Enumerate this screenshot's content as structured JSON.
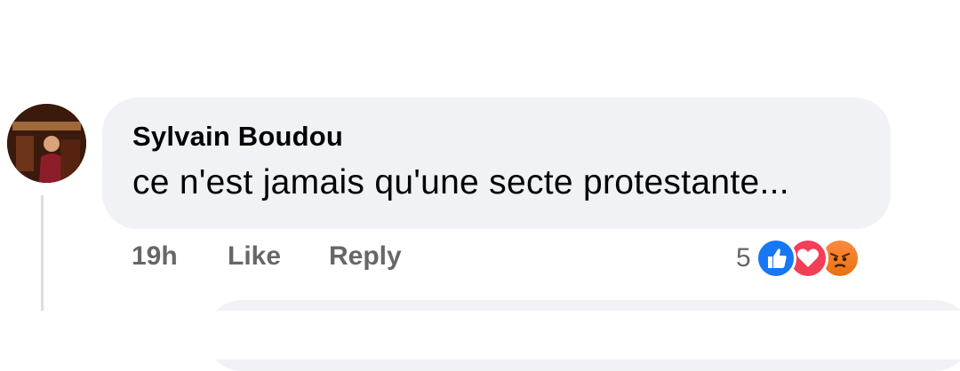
{
  "comment": {
    "author": "Sylvain Boudou",
    "text": "ce n'est jamais qu'une secte protestante...",
    "time": "19h",
    "like_label": "Like",
    "reply_label": "Reply",
    "reactions": {
      "count": "5",
      "types": [
        "like-icon",
        "love-icon",
        "angry-icon"
      ]
    }
  },
  "colors": {
    "bubble": "#f0f2f5",
    "meta_text": "#65676b",
    "like": "#1877f2",
    "love": "#f33e58",
    "angry": "#e9710f"
  }
}
